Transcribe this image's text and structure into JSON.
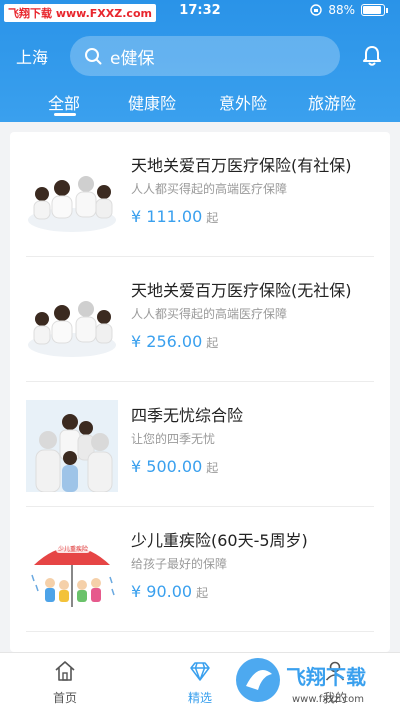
{
  "statusbar": {
    "watermark": "飞翔下载 www.FXXZ.com",
    "time": "17:32",
    "battery": "88%"
  },
  "header": {
    "city": "上海",
    "search_text": "e健保"
  },
  "tabs": [
    {
      "label": "全部"
    },
    {
      "label": "健康险"
    },
    {
      "label": "意外险"
    },
    {
      "label": "旅游险"
    }
  ],
  "products": [
    {
      "title": "天地关爱百万医疗保险(有社保)",
      "subtitle": "人人都买得起的高端医疗保障",
      "price": "¥ 111.00",
      "price_suffix": "起"
    },
    {
      "title": "天地关爱百万医疗保险(无社保)",
      "subtitle": "人人都买得起的高端医疗保障",
      "price": "¥ 256.00",
      "price_suffix": "起"
    },
    {
      "title": "四季无忧综合险",
      "subtitle": "让您的四季无忧",
      "price": "¥ 500.00",
      "price_suffix": "起"
    },
    {
      "title": "少儿重疾险(60天-5周岁)",
      "subtitle": "给孩子最好的保障",
      "price": "¥ 90.00",
      "price_suffix": "起"
    }
  ],
  "thumb4_label": "少儿重疾险",
  "bottom_nav": [
    {
      "label": "首页"
    },
    {
      "label": "精选"
    },
    {
      "label": "我的"
    }
  ],
  "brand": {
    "name": "飞翔下载",
    "url": "www.fxxz.com"
  },
  "colors": {
    "accent": "#3aa0ee",
    "header": "#2a93e8"
  }
}
